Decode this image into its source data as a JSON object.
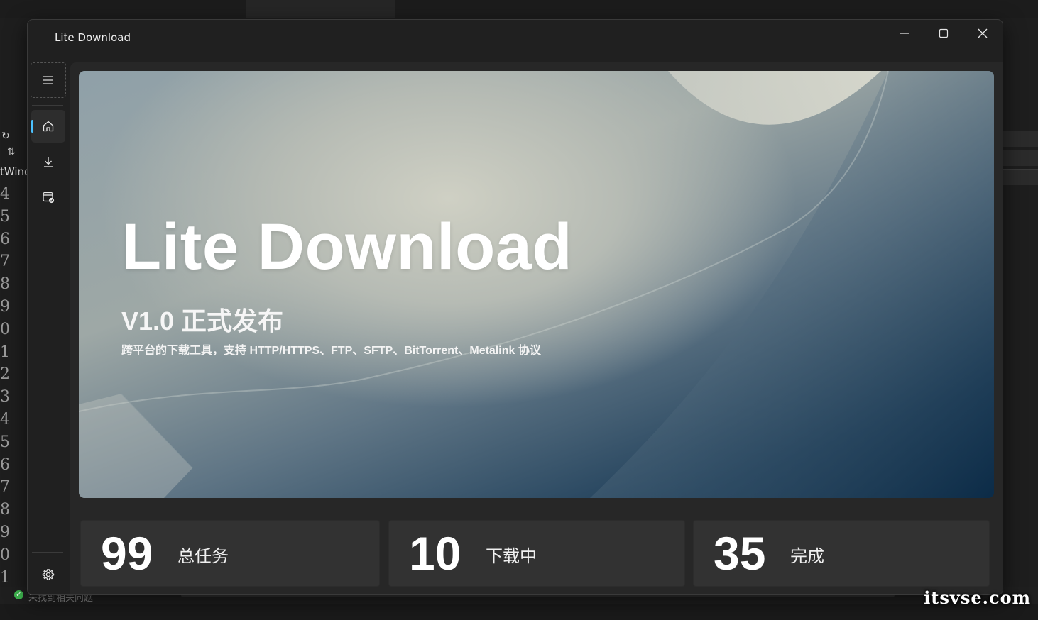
{
  "window": {
    "title": "Lite Download",
    "controls": {
      "minimize": "minimize-icon",
      "maximize": "maximize-icon",
      "close": "close-icon"
    }
  },
  "nav": {
    "menu_icon": "hamburger-icon",
    "items": [
      {
        "id": "home",
        "icon": "home-icon",
        "active": true
      },
      {
        "id": "downloads",
        "icon": "download-icon",
        "active": false
      },
      {
        "id": "completed",
        "icon": "completed-icon",
        "active": false
      }
    ],
    "settings_icon": "gear-icon"
  },
  "hero": {
    "title": "Lite Download",
    "version": "V1.0 正式发布",
    "description": "跨平台的下载工具，支持 HTTP/HTTPS、FTP、SFTP、BitTorrent、Metalink 协议"
  },
  "stats": [
    {
      "value": "99",
      "label": "总任务"
    },
    {
      "value": "10",
      "label": "下载中"
    },
    {
      "value": "35",
      "label": "完成"
    }
  ],
  "background_ide": {
    "tab_text": "tWind",
    "line_numbers": [
      "4",
      "5",
      "6",
      "7",
      "8",
      "9",
      "0",
      "1",
      "2",
      "3",
      "4",
      "5",
      "6",
      "7",
      "8",
      "9",
      "0",
      "1"
    ],
    "status_text": "未找到相关问题",
    "watermark": "itsvse.com"
  },
  "colors": {
    "accent": "#4cc2ff",
    "window_bg": "#202020",
    "card_bg": "#323232"
  }
}
